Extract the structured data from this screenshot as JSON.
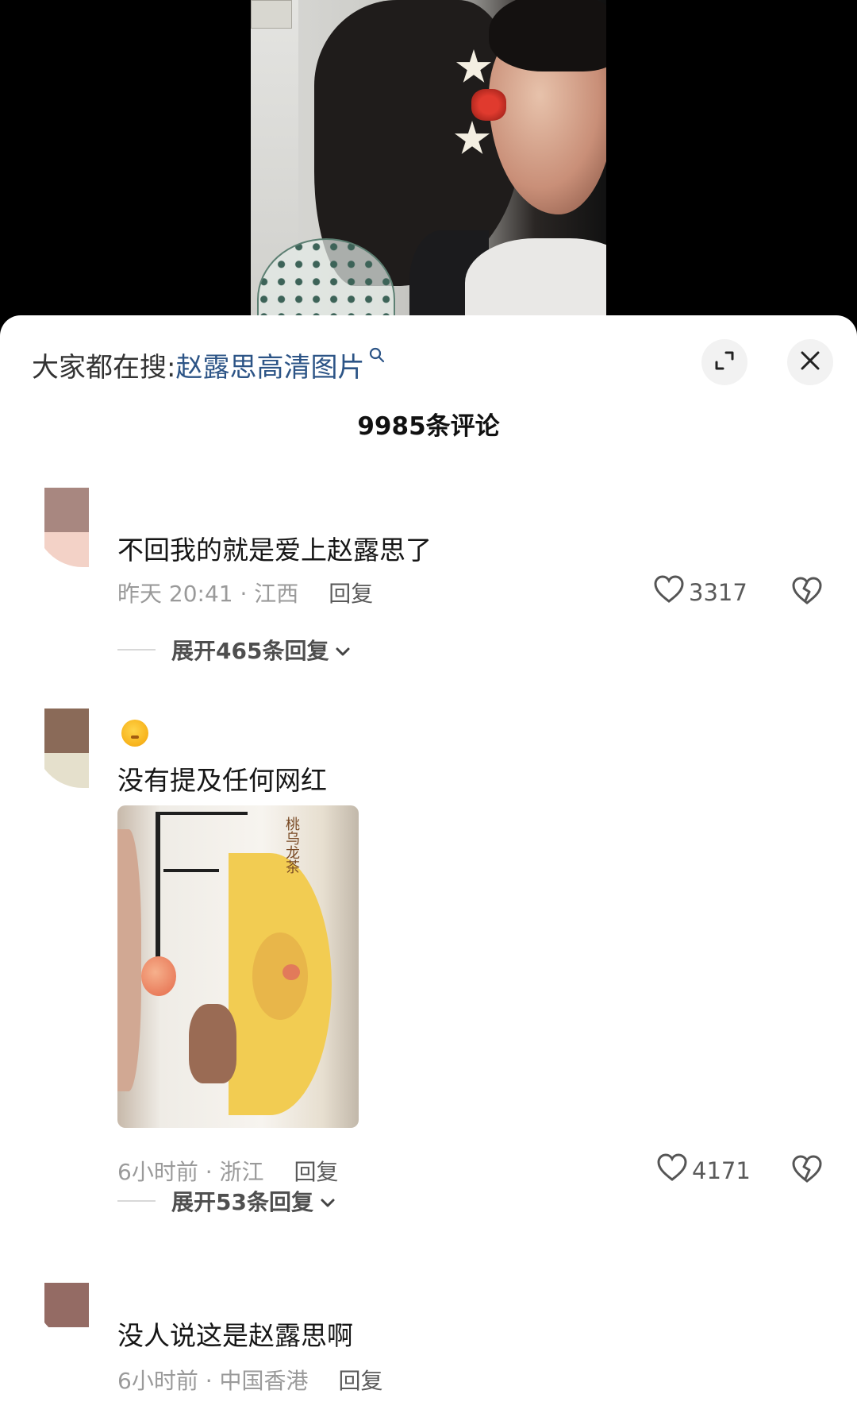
{
  "search": {
    "prefix": "大家都在搜:",
    "keyword": "赵露思高清图片"
  },
  "header": {
    "comment_count": "9985条评论"
  },
  "icons": {
    "search": "search-icon",
    "expand": "expand-icon",
    "close": "close-icon",
    "like": "heart-icon",
    "dislike": "broken-heart-icon",
    "chevron": "chevron-down-icon"
  },
  "comments": [
    {
      "text": "不回我的就是爱上赵露思了",
      "time_location": "昨天 20:41 · 江西",
      "reply_label": "回复",
      "likes": "3317",
      "expand_label": "展开465条回复"
    },
    {
      "text": "没有提及任何网红",
      "image_text": "桃乌龙茶",
      "time_location": "6小时前 · 浙江",
      "reply_label": "回复",
      "likes": "4171",
      "expand_label": "展开53条回复"
    },
    {
      "text": "没人说这是赵露思啊",
      "time_location": "6小时前 · 中国香港",
      "reply_label": "回复"
    }
  ]
}
